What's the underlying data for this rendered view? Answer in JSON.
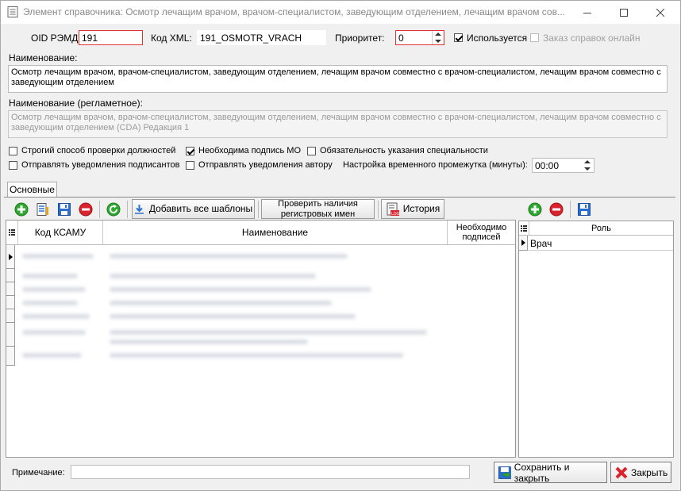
{
  "window": {
    "title": "Элемент справочника: Осмотр лечащим врачом, врачом-специалистом, заведующим отделением, лечащим врачом сов..."
  },
  "header": {
    "oid_label": "OID РЭМД:",
    "oid_value": "191",
    "xml_label": "Код XML:",
    "xml_value": "191_OSMOTR_VRACH",
    "priority_label": "Приоритет:",
    "priority_value": "0",
    "used_label": "Используется",
    "used_checked": true,
    "order_online_label": "Заказ справок онлайн",
    "order_online_checked": false
  },
  "name": {
    "label": "Наименование:",
    "value": "Осмотр лечащим врачом, врачом-специалистом, заведующим отделением, лечащим врачом совместно с врачом-специалистом, лечащим врачом совместно с заведующим отделением"
  },
  "reg_name": {
    "label": "Наименование (регламетное):",
    "value": "Осмотр лечащим врачом, врачом-специалистом, заведующим отделением, лечащим врачом совместно с врачом-специалистом, лечащим врачом совместно с заведующим отделением (CDA) Редакция 1"
  },
  "options": {
    "strict_check_label": "Строгий способ проверки должностей",
    "strict_check": false,
    "mo_sign_label": "Необходима подпись МО",
    "mo_sign": true,
    "specialty_label": "Обязательность указания специальности",
    "specialty": false,
    "notify_signers_label": "Отправлять уведомления подписантов",
    "notify_signers": false,
    "notify_author_label": "Отправлять уведомления автору",
    "notify_author": false,
    "interval_label": "Настройка временного промежутка (минуты):",
    "interval_value": "00:00"
  },
  "tabs": [
    {
      "label": "Основные",
      "active": true
    }
  ],
  "main_toolbar": {
    "add_all_label": "Добавить все шаблоны",
    "check_reg_label": "Проверить наличия регистровых имен",
    "history_label": "История"
  },
  "main_grid": {
    "columns": [
      "Код КСАМУ",
      "Наименование",
      "Необходимо подписей"
    ]
  },
  "role_grid": {
    "columns": [
      "Роль"
    ],
    "rows": [
      "Врач"
    ]
  },
  "footer": {
    "note_label": "Примечание:",
    "note_value": "",
    "save_close_label": "Сохранить и закрыть",
    "close_label": "Закрыть"
  },
  "colors": {
    "accent_green": "#2fa832",
    "accent_red": "#d9232d",
    "invalid_border": "#e03030"
  }
}
